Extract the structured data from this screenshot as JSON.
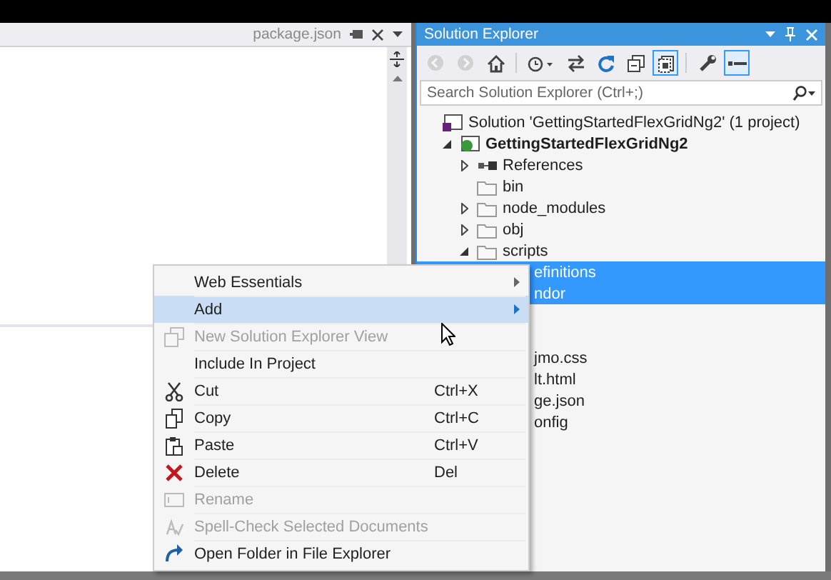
{
  "editor": {
    "tab": {
      "title": "package.json"
    }
  },
  "solution_explorer": {
    "title": "Solution Explorer",
    "toolbar": [
      {
        "kind": "back",
        "disabled": true,
        "selected": false
      },
      {
        "kind": "forward",
        "disabled": true,
        "selected": false
      },
      {
        "kind": "home",
        "disabled": false,
        "selected": false
      },
      {
        "kind": "history",
        "disabled": false,
        "selected": false
      },
      {
        "kind": "sync",
        "disabled": false,
        "selected": false
      },
      {
        "kind": "refresh",
        "disabled": false,
        "selected": false
      },
      {
        "kind": "collapse",
        "disabled": false,
        "selected": false
      },
      {
        "kind": "show-all",
        "disabled": false,
        "selected": true
      },
      {
        "kind": "properties",
        "disabled": false,
        "selected": false
      },
      {
        "kind": "preview",
        "disabled": false,
        "selected": true
      }
    ],
    "search": {
      "placeholder": "Search Solution Explorer (Ctrl+;)"
    },
    "tree": [
      {
        "kind": "solution",
        "label": "Solution 'GettingStartedFlexGridNg2' (1 project)",
        "selected": false,
        "children": [
          {
            "kind": "project",
            "label": "GettingStartedFlexGridNg2",
            "expanded": true,
            "selected": false,
            "children": [
              {
                "kind": "references",
                "label": "References",
                "expanded": false,
                "selected": false
              },
              {
                "kind": "folder",
                "label": "bin",
                "selected": false
              },
              {
                "kind": "folder",
                "label": "node_modules",
                "expanded": false,
                "selected": false
              },
              {
                "kind": "folder",
                "label": "obj",
                "expanded": false,
                "selected": false
              },
              {
                "kind": "folder",
                "label": "scripts",
                "expanded": true,
                "selected": false,
                "children": [
                  {
                    "kind": "partial",
                    "label": "efinitions",
                    "selected": true
                  },
                  {
                    "kind": "partial",
                    "label": "ndor",
                    "selected": true
                  }
                ]
              },
              {
                "kind": "partial",
                "label": "jmo.css",
                "selected": false,
                "gap": true
              },
              {
                "kind": "partial",
                "label": "lt.html",
                "selected": false
              },
              {
                "kind": "partial",
                "label": "ge.json",
                "selected": false
              },
              {
                "kind": "partial",
                "label": "onfig",
                "selected": false
              }
            ]
          }
        ]
      }
    ]
  },
  "context_menu": [
    {
      "kind": "plain",
      "label": "Web Essentials",
      "submenu": true,
      "selected": false,
      "disabled": false
    },
    {
      "kind": "plain",
      "label": "Add",
      "submenu": true,
      "selected": true,
      "disabled": false
    },
    {
      "kind": "new-view",
      "label": "New Solution Explorer View",
      "disabled": true,
      "selected": false
    },
    {
      "kind": "plain",
      "label": "Include In Project",
      "disabled": false,
      "selected": false
    },
    {
      "kind": "cut",
      "label": "Cut",
      "shortcut": "Ctrl+X",
      "disabled": false,
      "selected": false
    },
    {
      "kind": "copy",
      "label": "Copy",
      "shortcut": "Ctrl+C",
      "disabled": false,
      "selected": false
    },
    {
      "kind": "paste",
      "label": "Paste",
      "shortcut": "Ctrl+V",
      "disabled": false,
      "selected": false
    },
    {
      "kind": "delete",
      "label": "Delete",
      "shortcut": "Del",
      "disabled": false,
      "selected": false
    },
    {
      "kind": "rename",
      "label": "Rename",
      "disabled": true,
      "selected": false
    },
    {
      "kind": "spell",
      "label": "Spell-Check Selected Documents",
      "disabled": true,
      "selected": false
    },
    {
      "kind": "open-folder",
      "label": "Open Folder in File Explorer",
      "disabled": false,
      "selected": false
    }
  ]
}
